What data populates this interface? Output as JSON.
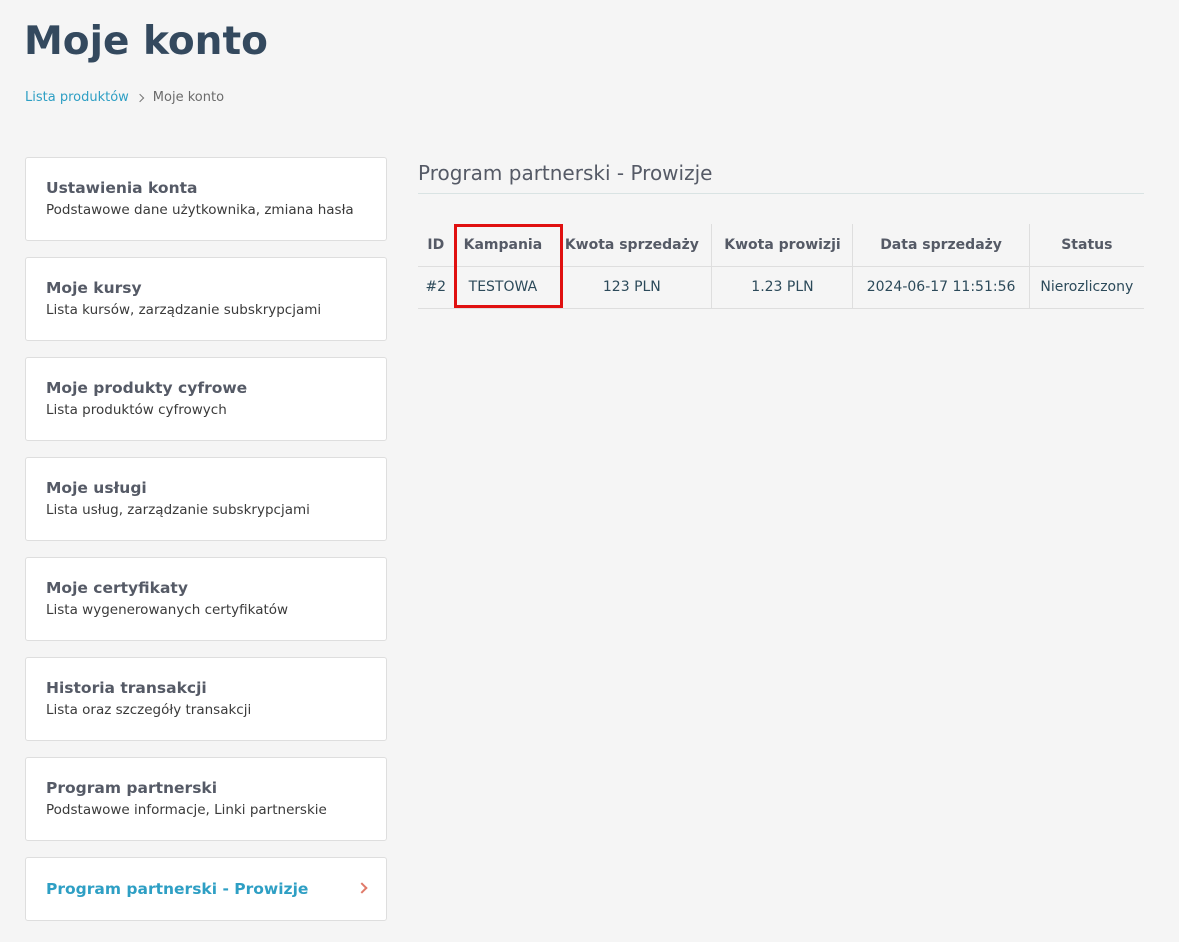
{
  "page": {
    "title": "Moje konto"
  },
  "breadcrumb": {
    "link_label": "Lista produktów",
    "current_label": "Moje konto"
  },
  "sidebar": {
    "items": [
      {
        "title": "Ustawienia konta",
        "description": "Podstawowe dane użytkownika, zmiana hasła"
      },
      {
        "title": "Moje kursy",
        "description": "Lista kursów, zarządzanie subskrypcjami"
      },
      {
        "title": "Moje produkty cyfrowe",
        "description": "Lista produktów cyfrowych"
      },
      {
        "title": "Moje usługi",
        "description": "Lista usług, zarządzanie subskrypcjami"
      },
      {
        "title": "Moje certyfikaty",
        "description": "Lista wygenerowanych certyfikatów"
      },
      {
        "title": "Historia transakcji",
        "description": "Lista oraz szczegóły transakcji"
      },
      {
        "title": "Program partnerski",
        "description": "Podstawowe informacje, Linki partnerskie"
      },
      {
        "title": "Program partnerski - Prowizje",
        "active": true,
        "icon": "chevron-right-icon"
      }
    ]
  },
  "main": {
    "section_title": "Program partnerski - Prowizje",
    "table": {
      "columns": [
        "ID",
        "Kampania",
        "Kwota sprzedaży",
        "Kwota prowizji",
        "Data sprzedaży",
        "Status"
      ],
      "rows": [
        [
          "#2",
          "TESTOWA",
          "123 PLN",
          "1.23 PLN",
          "2024-06-17 11:51:56",
          "Nierozliczony"
        ]
      ]
    },
    "highlight_color": "#e01010"
  },
  "colors": {
    "background": "#f5f5f5",
    "title": "#34495e",
    "accent": "#2e9fc4",
    "chevron": "#e07a6a"
  }
}
